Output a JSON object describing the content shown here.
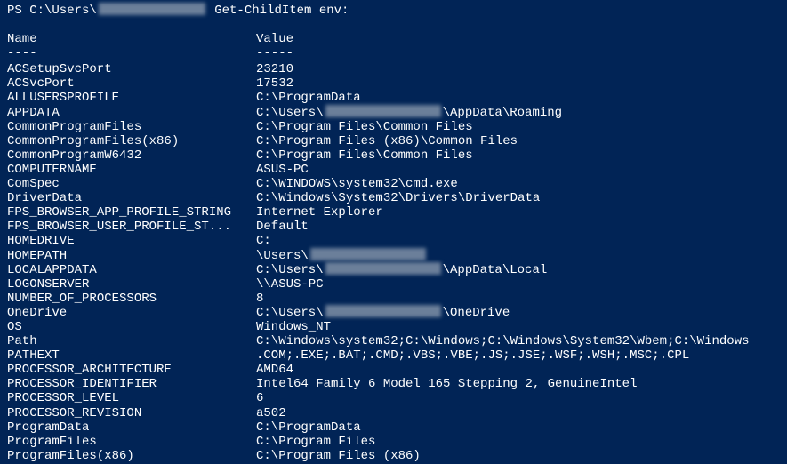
{
  "prompt": {
    "prefix": "PS C:\\Users\\",
    "command": " Get-ChildItem env:"
  },
  "headers": {
    "name": "Name",
    "value": "Value",
    "name_underline": "----",
    "value_underline": "-----"
  },
  "rows": [
    {
      "name": "ACSetupSvcPort",
      "value": "23210"
    },
    {
      "name": "ACSvcPort",
      "value": "17532"
    },
    {
      "name": "ALLUSERSPROFILE",
      "value": "C:\\ProgramData"
    },
    {
      "name": "APPDATA",
      "value_prefix": "C:\\Users\\",
      "redacted": true,
      "value_suffix": "\\AppData\\Roaming"
    },
    {
      "name": "CommonProgramFiles",
      "value": "C:\\Program Files\\Common Files"
    },
    {
      "name": "CommonProgramFiles(x86)",
      "value": "C:\\Program Files (x86)\\Common Files"
    },
    {
      "name": "CommonProgramW6432",
      "value": "C:\\Program Files\\Common Files"
    },
    {
      "name": "COMPUTERNAME",
      "value": "ASUS-PC"
    },
    {
      "name": "ComSpec",
      "value": "C:\\WINDOWS\\system32\\cmd.exe"
    },
    {
      "name": "DriverData",
      "value": "C:\\Windows\\System32\\Drivers\\DriverData"
    },
    {
      "name": "FPS_BROWSER_APP_PROFILE_STRING",
      "value": "Internet Explorer"
    },
    {
      "name": "FPS_BROWSER_USER_PROFILE_ST...",
      "value": "Default"
    },
    {
      "name": "HOMEDRIVE",
      "value": "C:"
    },
    {
      "name": "HOMEPATH",
      "value_prefix": "\\Users\\",
      "redacted": true,
      "value_suffix": ""
    },
    {
      "name": "LOCALAPPDATA",
      "value_prefix": "C:\\Users\\",
      "redacted": true,
      "value_suffix": "\\AppData\\Local"
    },
    {
      "name": "LOGONSERVER",
      "value": "\\\\ASUS-PC"
    },
    {
      "name": "NUMBER_OF_PROCESSORS",
      "value": "8"
    },
    {
      "name": "OneDrive",
      "value_prefix": "C:\\Users\\",
      "redacted": true,
      "value_suffix": "\\OneDrive"
    },
    {
      "name": "OS",
      "value": "Windows_NT"
    },
    {
      "name": "Path",
      "value": "C:\\Windows\\system32;C:\\Windows;C:\\Windows\\System32\\Wbem;C:\\Windows"
    },
    {
      "name": "PATHEXT",
      "value": ".COM;.EXE;.BAT;.CMD;.VBS;.VBE;.JS;.JSE;.WSF;.WSH;.MSC;.CPL"
    },
    {
      "name": "PROCESSOR_ARCHITECTURE",
      "value": "AMD64"
    },
    {
      "name": "PROCESSOR_IDENTIFIER",
      "value": "Intel64 Family 6 Model 165 Stepping 2, GenuineIntel"
    },
    {
      "name": "PROCESSOR_LEVEL",
      "value": "6"
    },
    {
      "name": "PROCESSOR_REVISION",
      "value": "a502"
    },
    {
      "name": "ProgramData",
      "value": "C:\\ProgramData"
    },
    {
      "name": "ProgramFiles",
      "value": "C:\\Program Files"
    },
    {
      "name": "ProgramFiles(x86)",
      "value": "C:\\Program Files (x86)"
    }
  ]
}
